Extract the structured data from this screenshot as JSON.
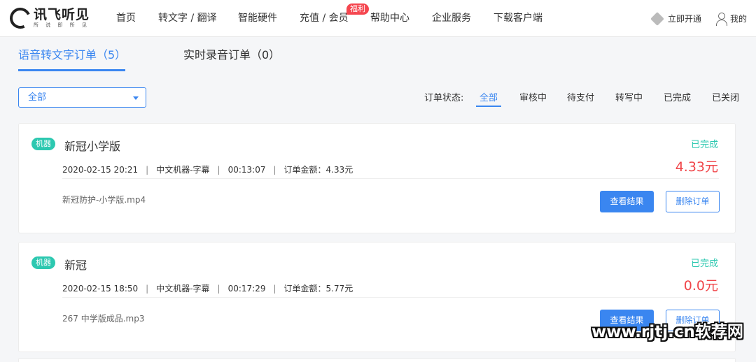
{
  "logo": {
    "name": "讯飞听见",
    "sub": "所 说 即 所 见"
  },
  "nav": [
    {
      "label": "首页"
    },
    {
      "label": "转文字 / 翻译"
    },
    {
      "label": "智能硬件"
    },
    {
      "label": "充值 / 会员",
      "badge": "福利"
    },
    {
      "label": "帮助中心"
    },
    {
      "label": "企业服务"
    },
    {
      "label": "下载客户端"
    }
  ],
  "header_right": {
    "vip_label": "立即开通",
    "mine_label": "我的"
  },
  "tabs": [
    {
      "label": "语音转文字订单（5）",
      "active": true
    },
    {
      "label": "实时录音订单（0）",
      "active": false
    }
  ],
  "select": {
    "value": "全部"
  },
  "filters": {
    "label": "订单状态:",
    "items": [
      "全部",
      "审核中",
      "待支付",
      "转写中",
      "已完成",
      "已关闭"
    ],
    "active": "全部"
  },
  "orders": [
    {
      "tag": "机器",
      "title": "新冠小学版",
      "date": "2020-02-15 20:21",
      "type": "中文机器-字幕",
      "duration": "00:13:07",
      "amount_text": "订单金额：4.33元",
      "file": "新冠防护-小学版.mp4",
      "status": "已完成",
      "amount": "4.33元",
      "view_label": "查看结果",
      "delete_label": "删除订单"
    },
    {
      "tag": "机器",
      "title": "新冠",
      "date": "2020-02-15 18:50",
      "type": "中文机器-字幕",
      "duration": "00:17:29",
      "amount_text": "订单金额：5.77元",
      "file": "267 中学版成品.mp3",
      "status": "已完成",
      "amount": "0.0元",
      "view_label": "查看结果",
      "delete_label": "删除订单"
    }
  ],
  "watermark": "www.rjtj.cn软荐网",
  "colors": {
    "accent": "#3a86f0",
    "tag": "#2cc8b0",
    "amount": "#f0464a",
    "badge": "#f5464f"
  }
}
